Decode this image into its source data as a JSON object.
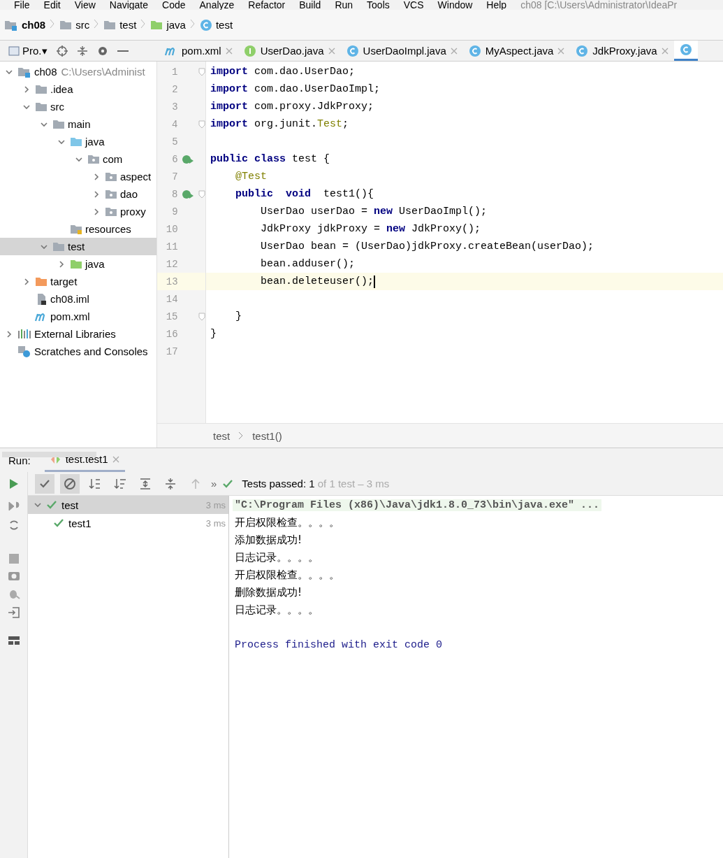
{
  "menu": [
    "File",
    "Edit",
    "View",
    "Navigate",
    "Code",
    "Analyze",
    "Refactor",
    "Build",
    "Run",
    "Tools",
    "VCS",
    "Window",
    "Help"
  ],
  "window_title": "ch08 [C:\\Users\\Administrator\\IdeaPr",
  "breadcrumb": [
    {
      "label": "ch08",
      "kind": "module"
    },
    {
      "label": "src",
      "kind": "folder"
    },
    {
      "label": "test",
      "kind": "folder"
    },
    {
      "label": "java",
      "kind": "test-folder"
    },
    {
      "label": "test",
      "kind": "class"
    }
  ],
  "project_tool": {
    "label": "Pro.▾"
  },
  "editor_tabs": [
    {
      "label": "pom.xml",
      "kind": "maven",
      "selected": false
    },
    {
      "label": "UserDao.java",
      "kind": "interface",
      "selected": false
    },
    {
      "label": "UserDaoImpl.java",
      "kind": "class",
      "selected": false
    },
    {
      "label": "MyAspect.java",
      "kind": "class",
      "selected": false
    },
    {
      "label": "JdkProxy.java",
      "kind": "class",
      "selected": false
    },
    {
      "kind": "class",
      "selected": true
    }
  ],
  "tree": [
    {
      "label": "ch08",
      "hint": "C:\\Users\\Administ",
      "kind": "module",
      "expanded": true,
      "selected": false,
      "children": [
        {
          "label": ".idea",
          "kind": "folder",
          "expanded": false,
          "selected": false
        },
        {
          "label": "src",
          "kind": "folder",
          "expanded": true,
          "selected": false,
          "children": [
            {
              "label": "main",
              "kind": "folder",
              "expanded": true,
              "selected": false,
              "children": [
                {
                  "label": "java",
                  "kind": "source-folder",
                  "expanded": true,
                  "selected": false,
                  "children": [
                    {
                      "label": "com",
                      "kind": "package",
                      "expanded": true,
                      "selected": false,
                      "children": [
                        {
                          "label": "aspect",
                          "kind": "package",
                          "expanded": false,
                          "selected": false
                        },
                        {
                          "label": "dao",
                          "kind": "package",
                          "expanded": false,
                          "selected": false
                        },
                        {
                          "label": "proxy",
                          "kind": "package",
                          "expanded": false,
                          "selected": false
                        }
                      ]
                    }
                  ]
                },
                {
                  "label": "resources",
                  "kind": "resources",
                  "selected": false
                }
              ]
            },
            {
              "label": "test",
              "kind": "folder",
              "expanded": true,
              "selected": true,
              "children": [
                {
                  "label": "java",
                  "kind": "test-folder",
                  "expanded": false,
                  "selected": false
                }
              ]
            }
          ]
        },
        {
          "label": "target",
          "kind": "excluded-folder",
          "expanded": false,
          "selected": false
        },
        {
          "label": "ch08.iml",
          "kind": "iml",
          "selected": false
        },
        {
          "label": "pom.xml",
          "kind": "maven",
          "selected": false
        }
      ]
    },
    {
      "label": "External Libraries",
      "kind": "libraries",
      "expanded": false,
      "selected": false
    },
    {
      "label": "Scratches and Consoles",
      "kind": "scratches",
      "selected": false
    }
  ],
  "code": [
    {
      "number": "1",
      "fold": true,
      "run": false,
      "current": false,
      "tokens": [
        {
          "kind": "keyword",
          "text": "import"
        },
        {
          "kind": "plain",
          "text": " com.dao.UserDao;"
        }
      ]
    },
    {
      "number": "2",
      "fold": false,
      "run": false,
      "current": false,
      "tokens": [
        {
          "kind": "keyword",
          "text": "import"
        },
        {
          "kind": "plain",
          "text": " com.dao.UserDaoImpl;"
        }
      ]
    },
    {
      "number": "3",
      "fold": false,
      "run": false,
      "current": false,
      "tokens": [
        {
          "kind": "keyword",
          "text": "import"
        },
        {
          "kind": "plain",
          "text": " com.proxy.JdkProxy;"
        }
      ]
    },
    {
      "number": "4",
      "fold": true,
      "run": false,
      "current": false,
      "tokens": [
        {
          "kind": "keyword",
          "text": "import"
        },
        {
          "kind": "plain",
          "text": " org.junit."
        },
        {
          "kind": "annotation",
          "text": "Test"
        },
        {
          "kind": "plain",
          "text": ";"
        }
      ]
    },
    {
      "number": "5",
      "fold": false,
      "run": false,
      "current": false
    },
    {
      "number": "6",
      "fold": false,
      "run": true,
      "current": false,
      "tokens": [
        {
          "kind": "keyword",
          "text": "public class"
        },
        {
          "kind": "plain",
          "text": " test {"
        }
      ]
    },
    {
      "number": "7",
      "fold": false,
      "run": false,
      "current": false,
      "tokens": [
        {
          "kind": "annotation",
          "text": "    @Test"
        }
      ]
    },
    {
      "number": "8",
      "fold": true,
      "run": true,
      "current": false,
      "tokens": [
        {
          "kind": "keyword",
          "text": "    public"
        },
        {
          "kind": "keyword",
          "text": "  void"
        },
        {
          "kind": "plain",
          "text": "  test1(){"
        }
      ]
    },
    {
      "number": "9",
      "fold": false,
      "run": false,
      "current": false,
      "tokens": [
        {
          "kind": "plain",
          "text": "        UserDao userDao = "
        },
        {
          "kind": "keyword",
          "text": "new"
        },
        {
          "kind": "plain",
          "text": " UserDaoImpl();"
        }
      ]
    },
    {
      "number": "10",
      "fold": false,
      "run": false,
      "current": false,
      "tokens": [
        {
          "kind": "plain",
          "text": "        JdkProxy jdkProxy = "
        },
        {
          "kind": "keyword",
          "text": "new"
        },
        {
          "kind": "plain",
          "text": " JdkProxy();"
        }
      ]
    },
    {
      "number": "11",
      "fold": false,
      "run": false,
      "current": false,
      "tokens": [
        {
          "kind": "plain",
          "text": "        UserDao bean = (UserDao)jdkProxy.createBean(userDao);"
        }
      ]
    },
    {
      "number": "12",
      "fold": false,
      "run": false,
      "current": false,
      "tokens": [
        {
          "kind": "plain",
          "text": "        bean.adduser();"
        }
      ]
    },
    {
      "number": "13",
      "fold": false,
      "run": false,
      "current": true,
      "tokens": [
        {
          "kind": "plain",
          "text": "        bean.deleteuser();"
        }
      ]
    },
    {
      "number": "14",
      "fold": false,
      "run": false,
      "current": false
    },
    {
      "number": "15",
      "fold": true,
      "run": false,
      "current": false,
      "tokens": [
        {
          "kind": "plain",
          "text": "    }"
        }
      ]
    },
    {
      "number": "16",
      "fold": false,
      "run": false,
      "current": false,
      "tokens": [
        {
          "kind": "plain",
          "text": "}"
        }
      ]
    },
    {
      "number": "17",
      "fold": false,
      "run": false,
      "current": false
    }
  ],
  "editor_breadcrumb": [
    "test",
    "test1()"
  ],
  "run": {
    "label": "Run:",
    "tab": "test.test1",
    "status": "Tests passed: 1",
    "status_detail": "of 1 test – 3 ms",
    "more": "»",
    "filters": [
      {
        "kind": "check",
        "selected": true
      },
      {
        "kind": "ban",
        "selected": true
      }
    ],
    "tests": [
      {
        "label": "test",
        "time": "3 ms",
        "selected": true,
        "children": [
          {
            "label": "test1",
            "time": "3 ms",
            "selected": false
          }
        ]
      }
    ],
    "console": [
      {
        "kind": "command",
        "text": "\"C:\\Program Files (x86)\\Java\\jdk1.8.0_73\\bin\\java.exe\" ..."
      },
      {
        "kind": "output",
        "text": "开启权限检查。。。。"
      },
      {
        "kind": "output",
        "text": "添加数据成功!"
      },
      {
        "kind": "output",
        "text": "日志记录。。。。"
      },
      {
        "kind": "output",
        "text": "开启权限检查。。。。"
      },
      {
        "kind": "output",
        "text": "删除数据成功!"
      },
      {
        "kind": "output",
        "text": "日志记录。。。。"
      },
      {
        "kind": "blank"
      },
      {
        "kind": "exit",
        "text": "Process finished with exit code 0"
      }
    ]
  }
}
